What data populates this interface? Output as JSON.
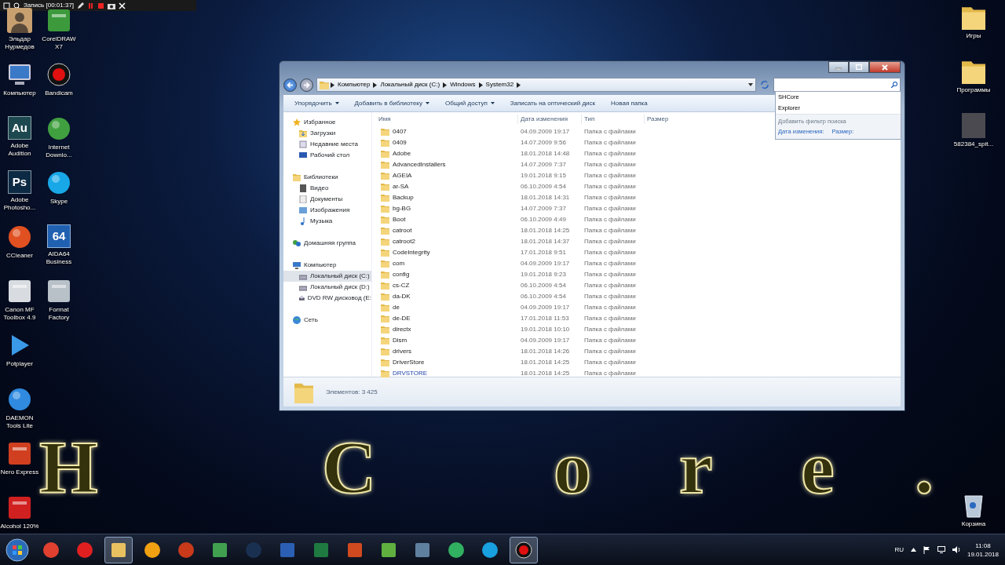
{
  "recording_bar": {
    "title": "Запись [00:01:37]"
  },
  "desktop_left": [
    {
      "label": "Эльдар Нурмедов",
      "kind": "avatar",
      "color": "#c8a070"
    },
    {
      "label": "Компьютер",
      "kind": "monitor",
      "color": "#3a78c8"
    },
    {
      "label": "Adobe Audition",
      "kind": "tile",
      "glyph": "Au",
      "color": "#1d4850"
    },
    {
      "label": "Adobe Photosho...",
      "kind": "tile",
      "glyph": "Ps",
      "color": "#0c2a44"
    },
    {
      "label": "CCleaner",
      "kind": "orb",
      "color": "#e05020"
    },
    {
      "label": "Canon MF Toolbox 4.9",
      "kind": "square",
      "color": "#d8dce0"
    },
    {
      "label": "Potplayer",
      "kind": "play",
      "color": "#3a9ae8"
    },
    {
      "label": "DAEMON Tools Lite",
      "kind": "orb",
      "color": "#2f8ae0"
    },
    {
      "label": "Nero Express",
      "kind": "square",
      "color": "#d04020"
    },
    {
      "label": "Alcohol 120%",
      "kind": "square",
      "color": "#d02020"
    },
    {
      "label": "CorelDRAW X7",
      "kind": "square",
      "color": "#3c9a3c"
    },
    {
      "label": "Bandicam",
      "kind": "record",
      "color": "#e01010"
    },
    {
      "label": "Internet Downlo...",
      "kind": "orb",
      "color": "#40a040"
    },
    {
      "label": "Skype",
      "kind": "orb",
      "color": "#18a8e8"
    },
    {
      "label": "AIDA64 Business",
      "kind": "tile",
      "glyph": "64",
      "color": "#2060b0"
    },
    {
      "label": "Format Factory",
      "kind": "square",
      "color": "#b8c0c8"
    }
  ],
  "desktop_right": [
    {
      "label": "Игры",
      "kind": "folder"
    },
    {
      "label": "Программы",
      "kind": "folder"
    },
    {
      "label": "582384_spit...",
      "kind": "photo"
    }
  ],
  "recycle_bin": {
    "label": "Корзина"
  },
  "wallpaper_text": [
    "H",
    "C",
    "o",
    "r",
    "e",
    "."
  ],
  "explorer": {
    "breadcrumbs": [
      "Компьютер",
      "Локальный диск (C:)",
      "Windows",
      "System32"
    ],
    "search_menu": {
      "suggestions": [
        "SHCore",
        "Explorer"
      ],
      "hint": "Добавить фильтр поиска",
      "filters": [
        "Дата изменения:",
        "Размер:"
      ]
    },
    "toolbar": [
      {
        "label": "Упорядочить",
        "has_menu": true
      },
      {
        "label": "Добавить в библиотеку",
        "has_menu": true
      },
      {
        "label": "Общий доступ",
        "has_menu": true
      },
      {
        "label": "Записать на оптический диск",
        "has_menu": false
      },
      {
        "label": "Новая папка",
        "has_menu": false
      }
    ],
    "nav": [
      {
        "label": "Избранное",
        "kind": "star",
        "selected": false,
        "children": [
          {
            "label": "Загрузки",
            "kind": "download",
            "selected": false
          },
          {
            "label": "Недавние места",
            "kind": "recent",
            "selected": false
          },
          {
            "label": "Рабочий стол",
            "kind": "desktop",
            "selected": false
          }
        ]
      },
      {
        "label": "Библиотеки",
        "kind": "library",
        "selected": false,
        "children": [
          {
            "label": "Видео",
            "kind": "video",
            "selected": false
          },
          {
            "label": "Документы",
            "kind": "document",
            "selected": false
          },
          {
            "label": "Изображения",
            "kind": "image",
            "selected": false
          },
          {
            "label": "Музыка",
            "kind": "music",
            "selected": false
          }
        ]
      },
      {
        "label": "Домашняя группа",
        "kind": "homegroup",
        "selected": false
      },
      {
        "label": "Компьютер",
        "kind": "computer",
        "selected": false,
        "children": [
          {
            "label": "Локальный диск (C:)",
            "kind": "drive",
            "selected": true
          },
          {
            "label": "Локальный диск (D:)",
            "kind": "drive",
            "selected": false
          },
          {
            "label": "DVD RW дисковод (E:",
            "kind": "disc",
            "selected": false
          }
        ]
      },
      {
        "label": "Сеть",
        "kind": "network",
        "selected": false
      }
    ],
    "columns": [
      "Имя",
      "Дата изменения",
      "Тип",
      "Размер"
    ],
    "rows": [
      {
        "name": "0407",
        "date": "04.09.2009 19:17",
        "type": "Папка с файлами",
        "highlighted": false
      },
      {
        "name": "0409",
        "date": "14.07.2009 9:56",
        "type": "Папка с файлами",
        "highlighted": false
      },
      {
        "name": "Adobe",
        "date": "18.01.2018 14:48",
        "type": "Папка с файлами",
        "highlighted": false
      },
      {
        "name": "AdvancedInstallers",
        "date": "14.07.2009 7:37",
        "type": "Папка с файлами",
        "highlighted": false
      },
      {
        "name": "AGEIA",
        "date": "19.01.2018 9:15",
        "type": "Папка с файлами",
        "highlighted": false
      },
      {
        "name": "ar-SA",
        "date": "06.10.2009 4:54",
        "type": "Папка с файлами",
        "highlighted": false
      },
      {
        "name": "Backup",
        "date": "18.01.2018 14:31",
        "type": "Папка с файлами",
        "highlighted": false
      },
      {
        "name": "bg-BG",
        "date": "14.07.2009 7:37",
        "type": "Папка с файлами",
        "highlighted": false
      },
      {
        "name": "Boot",
        "date": "06.10.2009 4:49",
        "type": "Папка с файлами",
        "highlighted": false
      },
      {
        "name": "catroot",
        "date": "18.01.2018 14:25",
        "type": "Папка с файлами",
        "highlighted": false
      },
      {
        "name": "catroot2",
        "date": "18.01.2018 14:37",
        "type": "Папка с файлами",
        "highlighted": false
      },
      {
        "name": "CodeIntegrity",
        "date": "17.01.2018 9:51",
        "type": "Папка с файлами",
        "highlighted": false
      },
      {
        "name": "com",
        "date": "04.09.2009 19:17",
        "type": "Папка с файлами",
        "highlighted": false
      },
      {
        "name": "config",
        "date": "19.01.2018 9:23",
        "type": "Папка с файлами",
        "highlighted": false
      },
      {
        "name": "cs-CZ",
        "date": "06.10.2009 4:54",
        "type": "Папка с файлами",
        "highlighted": false
      },
      {
        "name": "da-DK",
        "date": "06.10.2009 4:54",
        "type": "Папка с файлами",
        "highlighted": false
      },
      {
        "name": "de",
        "date": "04.09.2009 19:17",
        "type": "Папка с файлами",
        "highlighted": false
      },
      {
        "name": "de-DE",
        "date": "17.01.2018 11:53",
        "type": "Папка с файлами",
        "highlighted": false
      },
      {
        "name": "directx",
        "date": "19.01.2018 10:10",
        "type": "Папка с файлами",
        "highlighted": false
      },
      {
        "name": "Dism",
        "date": "04.09.2009 19:17",
        "type": "Папка с файлами",
        "highlighted": false
      },
      {
        "name": "drivers",
        "date": "18.01.2018 14:26",
        "type": "Папка с файлами",
        "highlighted": false
      },
      {
        "name": "DriverStore",
        "date": "18.01.2018 14:25",
        "type": "Папка с файлами",
        "highlighted": false
      },
      {
        "name": "DRVSTORE",
        "date": "18.01.2018 14:25",
        "type": "Папка с файлами",
        "highlighted": true
      }
    ],
    "status": "Элементов: 3 425"
  },
  "taskbar": {
    "apps": [
      {
        "kind": "orb",
        "color": "#e04030",
        "active": false
      },
      {
        "kind": "orb",
        "color": "#e02020",
        "active": false
      },
      {
        "kind": "tile",
        "color": "#e8c060",
        "active": true
      },
      {
        "kind": "orb",
        "color": "#f0a010",
        "active": false
      },
      {
        "kind": "orb",
        "color": "#c83a1a",
        "active": false
      },
      {
        "kind": "tile",
        "color": "#40a050",
        "active": false
      },
      {
        "kind": "orb",
        "color": "#1a3050",
        "active": false
      },
      {
        "kind": "tile",
        "color": "#2b5fb4",
        "active": false
      },
      {
        "kind": "tile",
        "color": "#1e7a40",
        "active": false
      },
      {
        "kind": "tile",
        "color": "#d04a20",
        "active": false
      },
      {
        "kind": "tile",
        "color": "#60b040",
        "active": false
      },
      {
        "kind": "tile",
        "color": "#6080a0",
        "active": false
      },
      {
        "kind": "orb",
        "color": "#30b060",
        "active": false
      },
      {
        "kind": "orb",
        "color": "#18a0e0",
        "active": false
      },
      {
        "kind": "record",
        "color": "#e01010",
        "active": true
      }
    ],
    "language": "RU",
    "time": "11:08",
    "date": "19.01.2018"
  }
}
